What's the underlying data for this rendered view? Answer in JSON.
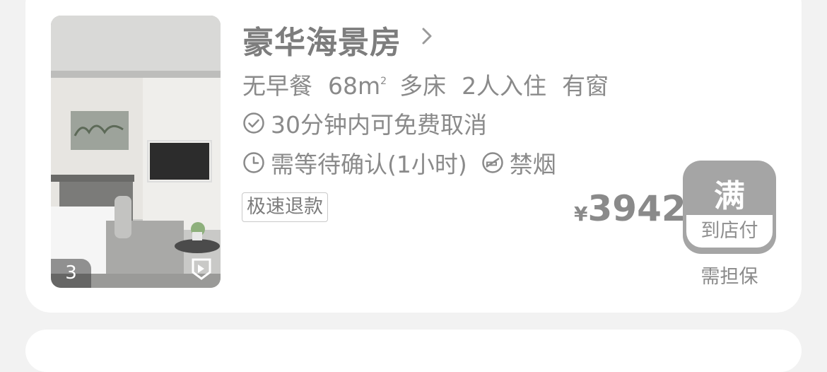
{
  "room": {
    "title": "豪华海景房",
    "specs": [
      "无早餐",
      "68m",
      "多床",
      "2人入住",
      "有窗"
    ],
    "area_unit_sup": "2",
    "cancel_policy": "30分钟内可免费取消",
    "confirm_policy": "需等待确认(1小时)",
    "smoking": "禁烟",
    "tag": "极速退款"
  },
  "photo": {
    "count": "3"
  },
  "price": {
    "currency": "¥",
    "amount": "3942"
  },
  "booking": {
    "status": "满",
    "payment": "到店付",
    "guarantee": "需担保"
  },
  "colors": {
    "card_bg": "#ffffff",
    "page_bg": "#f2f2f2",
    "button_bg": "#a5a5a5",
    "text_gray": "#8a8a8a"
  },
  "icons": [
    "check-circle-icon",
    "clock-icon",
    "no-smoking-icon",
    "chevron-right-icon",
    "photo-badge-icon"
  ]
}
